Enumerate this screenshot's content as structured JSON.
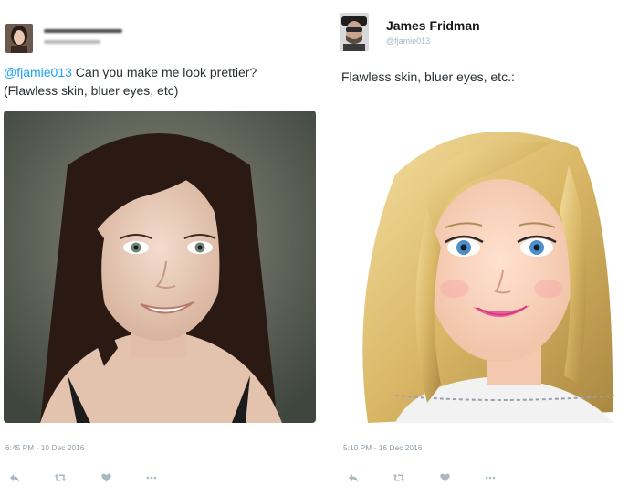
{
  "left_tweet": {
    "author_handle": "@fjamie013",
    "text_line1": " Can you make me look prettier?",
    "text_line2": "(Flawless skin, bluer eyes, etc)",
    "timestamp": "6:45 PM - 10 Dec 2016"
  },
  "right_tweet": {
    "author_name": "James Fridman",
    "author_handle": "@fjamie013",
    "text": "Flawless skin, bluer eyes, etc.:",
    "timestamp": "5:10 PM - 16 Dec 2016"
  },
  "icons": [
    "reply-icon",
    "retweet-icon",
    "like-icon",
    "more-icon"
  ],
  "colors": {
    "mention": "#1da1f2",
    "text": "#292f33",
    "muted": "#8899a6",
    "icon": "#aab8c2"
  }
}
